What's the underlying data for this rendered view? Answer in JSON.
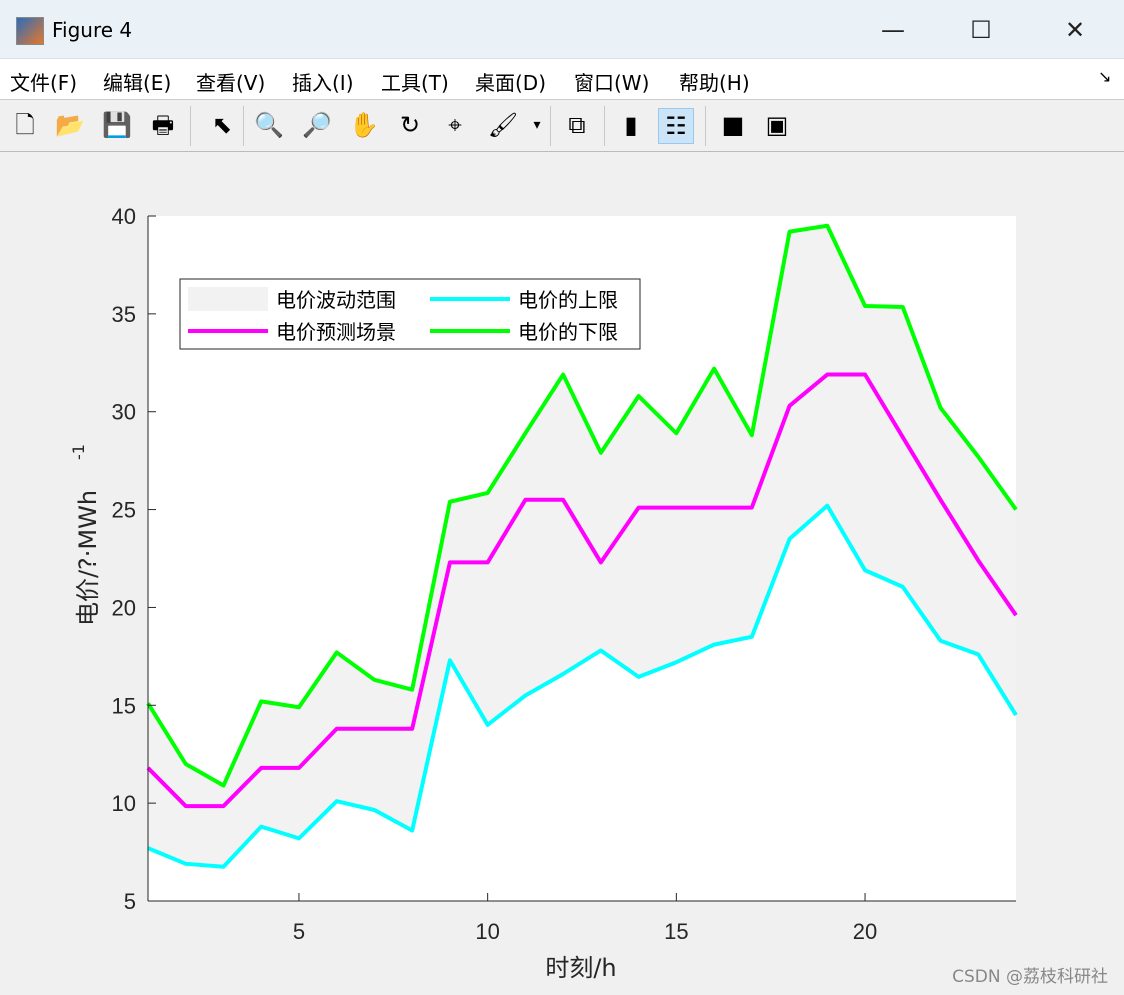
{
  "window": {
    "title": "Figure 4",
    "minimize": "—",
    "maximize": "☐",
    "close": "✕"
  },
  "menu": [
    "文件(F)",
    "编辑(E)",
    "查看(V)",
    "插入(I)",
    "工具(T)",
    "桌面(D)",
    "窗口(W)",
    "帮助(H)"
  ],
  "menu_extra": "↘",
  "toolbar": [
    {
      "name": "new-file-icon",
      "glyph": "🗋"
    },
    {
      "name": "open-folder-icon",
      "glyph": "📂"
    },
    {
      "name": "save-icon",
      "glyph": "💾"
    },
    {
      "name": "print-icon",
      "glyph": "🖶"
    },
    {
      "name": "pointer-icon",
      "glyph": "⬉"
    },
    {
      "name": "zoom-in-icon",
      "glyph": "🔍"
    },
    {
      "name": "zoom-out-icon",
      "glyph": "🔎"
    },
    {
      "name": "pan-hand-icon",
      "glyph": "✋"
    },
    {
      "name": "rotate-3d-icon",
      "glyph": "↻"
    },
    {
      "name": "data-cursor-icon",
      "glyph": "⌖"
    },
    {
      "name": "brush-icon",
      "glyph": "🖌"
    },
    {
      "name": "brush-dropdown-icon",
      "glyph": "▾"
    },
    {
      "name": "link-plot-icon",
      "glyph": "⧉"
    },
    {
      "name": "colorbar-icon",
      "glyph": "▮"
    },
    {
      "name": "legend-icon",
      "glyph": "☷"
    },
    {
      "name": "hide-plot-tools-icon",
      "glyph": "■"
    },
    {
      "name": "show-plot-tools-icon",
      "glyph": "▣"
    }
  ],
  "watermark": "CSDN @荔枝科研社",
  "chart_data": {
    "type": "line",
    "xlabel": "时刻/h",
    "ylabel": "电价/?·MWh",
    "ylabel_sup": "-1",
    "xlim": [
      1,
      24
    ],
    "ylim": [
      5,
      40
    ],
    "xticks": [
      5,
      10,
      15,
      20
    ],
    "yticks": [
      5,
      10,
      15,
      20,
      25,
      30,
      35,
      40
    ],
    "legend_position": "top-left",
    "x": [
      1,
      2,
      3,
      4,
      5,
      6,
      7,
      8,
      9,
      10,
      11,
      12,
      13,
      14,
      15,
      16,
      17,
      18,
      19,
      20,
      21,
      22,
      23,
      24
    ],
    "band": {
      "name": "电价波动范围",
      "color": "#f2f2f2"
    },
    "series": [
      {
        "name": "电价预测场景",
        "color": "#ff00ff",
        "values": [
          11.8,
          9.85,
          9.85,
          11.8,
          11.8,
          13.8,
          13.8,
          13.8,
          22.3,
          22.3,
          25.5,
          25.5,
          22.3,
          25.1,
          25.1,
          25.1,
          25.1,
          30.3,
          31.9,
          31.9,
          28.7,
          25.5,
          22.4,
          19.6
        ]
      },
      {
        "name": "电价的上限",
        "color": "#00ffff",
        "values": [
          7.7,
          6.9,
          6.75,
          8.8,
          8.2,
          10.1,
          9.65,
          8.6,
          17.3,
          14.0,
          15.5,
          16.6,
          17.8,
          16.45,
          17.2,
          18.1,
          18.5,
          23.5,
          25.2,
          21.9,
          21.05,
          18.3,
          17.6,
          14.5
        ]
      },
      {
        "name": "电价的下限",
        "color": "#00ff00",
        "values": [
          15.1,
          12.0,
          10.9,
          15.2,
          14.9,
          17.7,
          16.3,
          15.8,
          25.4,
          25.85,
          28.9,
          31.9,
          27.9,
          30.8,
          28.9,
          32.2,
          28.8,
          39.2,
          39.5,
          35.4,
          35.35,
          30.2,
          27.7,
          25.0
        ]
      }
    ]
  }
}
